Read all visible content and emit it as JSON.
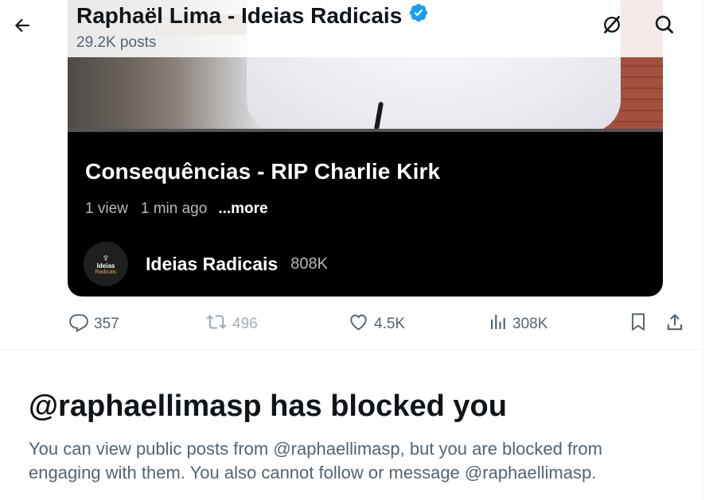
{
  "header": {
    "profile_name": "Raphaël Lima - Ideias Radicais",
    "post_count": "29.2K posts"
  },
  "video": {
    "title": "Consequências - RIP Charlie Kirk",
    "views": "1 view",
    "time": "1 min ago",
    "more": "...more",
    "channel_name": "Ideias Radicais",
    "channel_subs": "808K",
    "avatar_text": "Ideias",
    "avatar_sub": "Radicais"
  },
  "actions": {
    "replies": "357",
    "reposts": "496",
    "likes": "4.5K",
    "views": "308K"
  },
  "blocked": {
    "title": "@raphaellimasp has blocked you",
    "description": "You can view public posts from @raphaellimasp, but you are blocked from engaging with them. You also cannot follow or message @raphaellimasp."
  },
  "colors": {
    "text_primary": "#0f1419",
    "text_secondary": "#536471",
    "verified_blue": "#1d9bf0",
    "video_background": "#000000"
  },
  "icons": {
    "back": "arrow-left-icon",
    "verified": "verified-badge-icon",
    "grok": "grok-icon",
    "search": "search-icon",
    "reply": "reply-icon",
    "repost": "repost-icon",
    "like": "heart-icon",
    "views": "analytics-icon",
    "bookmark": "bookmark-icon",
    "share": "share-icon"
  }
}
